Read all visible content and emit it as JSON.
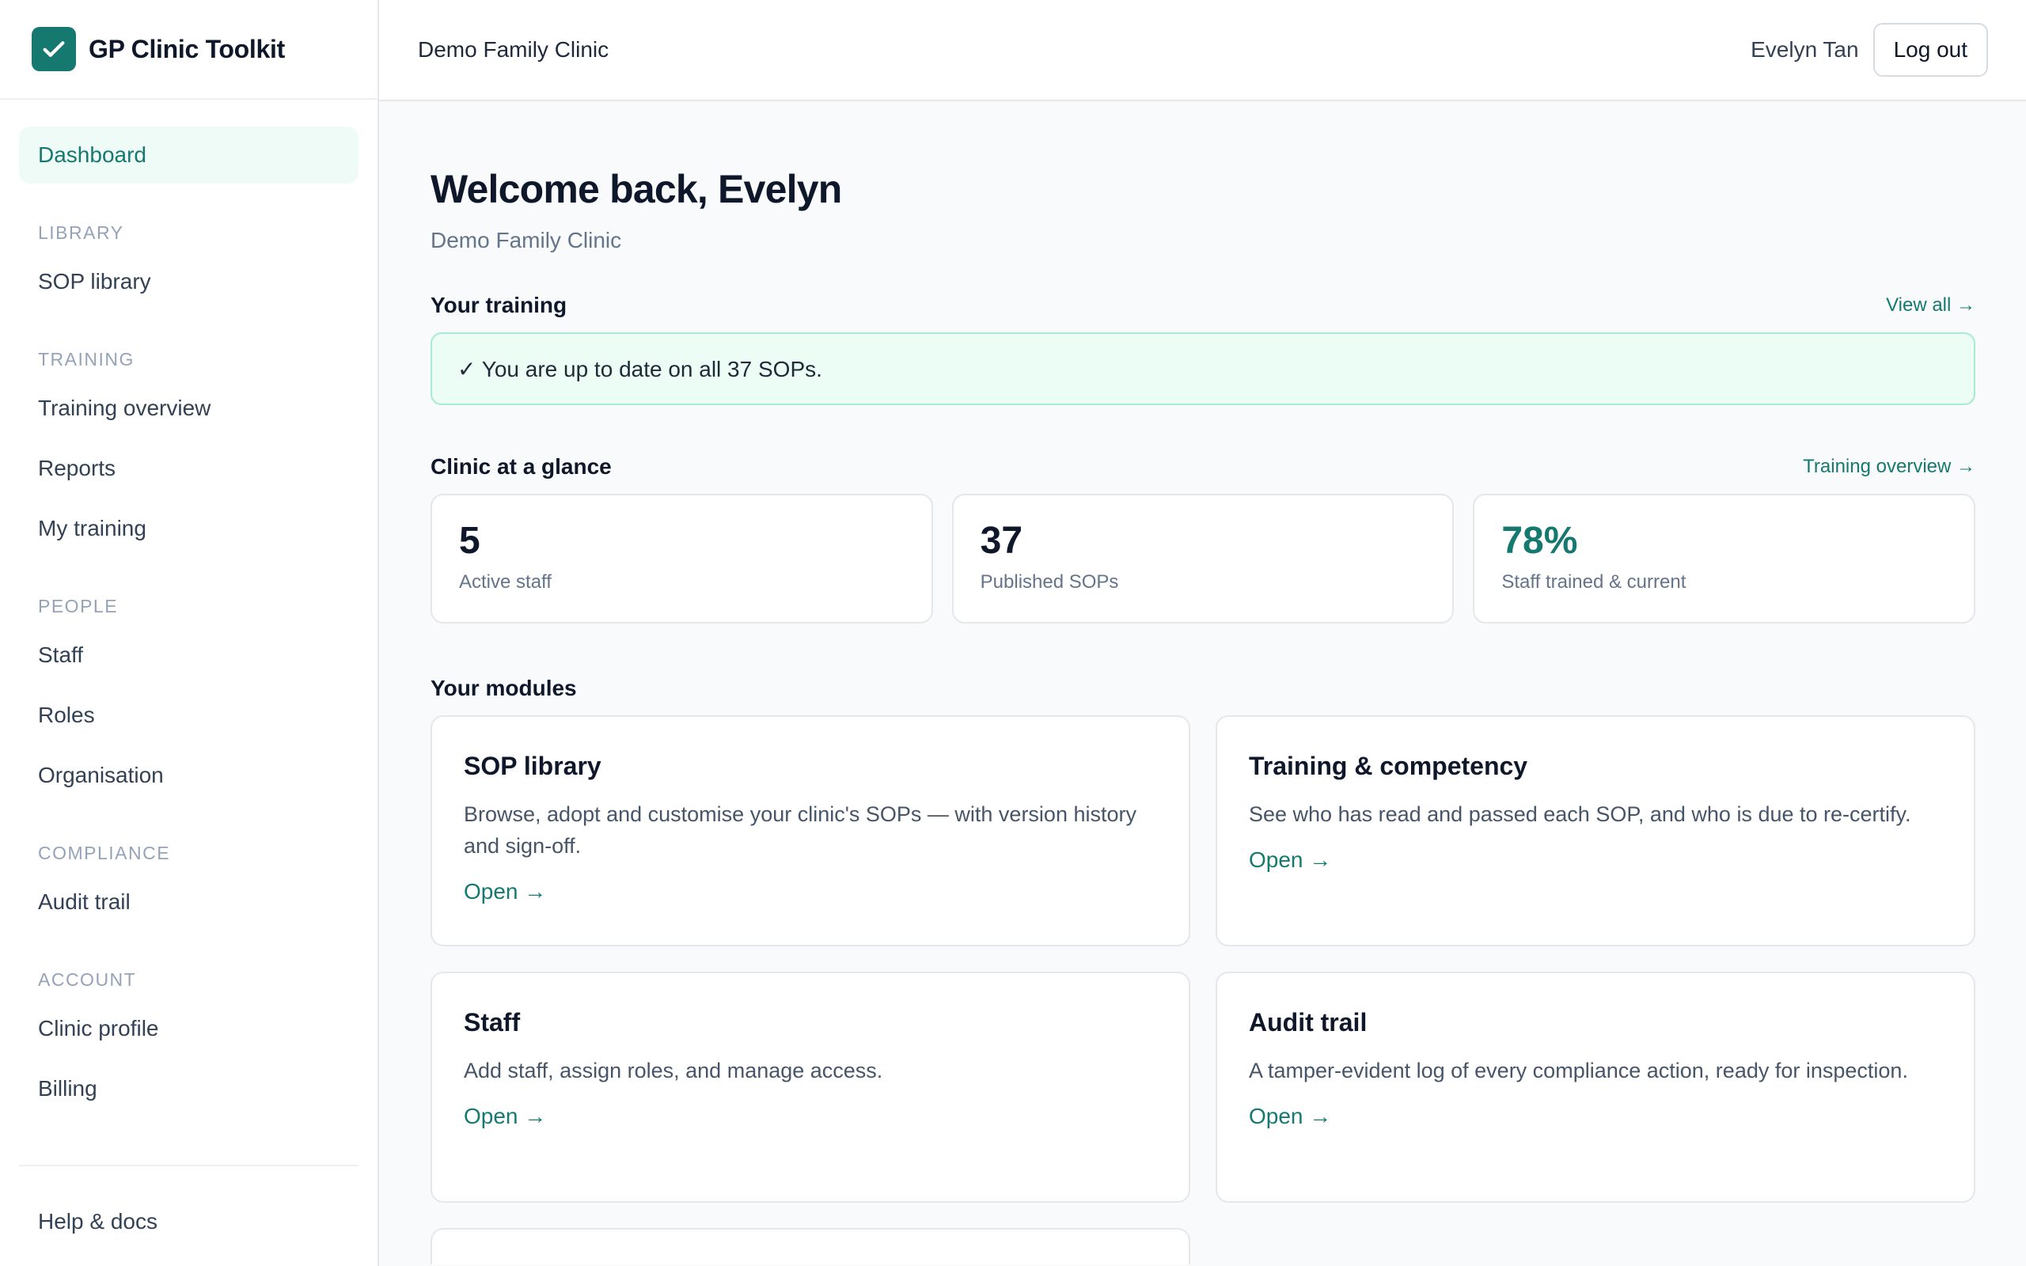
{
  "brand": {
    "name": "GP Clinic Toolkit",
    "logo_icon": "check-icon",
    "accent": "#16796f"
  },
  "sidebar": {
    "dashboard": "Dashboard",
    "sections": [
      {
        "label": "LIBRARY",
        "items": [
          "SOP library"
        ]
      },
      {
        "label": "TRAINING",
        "items": [
          "Training overview",
          "Reports",
          "My training"
        ]
      },
      {
        "label": "PEOPLE",
        "items": [
          "Staff",
          "Roles",
          "Organisation"
        ]
      },
      {
        "label": "COMPLIANCE",
        "items": [
          "Audit trail"
        ]
      },
      {
        "label": "ACCOUNT",
        "items": [
          "Clinic profile",
          "Billing"
        ]
      }
    ],
    "help": "Help & docs"
  },
  "header": {
    "clinic": "Demo Family Clinic",
    "user": "Evelyn Tan",
    "logout": "Log out"
  },
  "main": {
    "welcome": "Welcome back, Evelyn",
    "clinic": "Demo Family Clinic",
    "training": {
      "title": "Your training",
      "link": "View all →",
      "notice": "✓ You are up to date on all 37 SOPs."
    },
    "glance": {
      "title": "Clinic at a glance",
      "link": "Training overview →",
      "stats": [
        {
          "value": "5",
          "label": "Active staff"
        },
        {
          "value": "37",
          "label": "Published SOPs"
        },
        {
          "value": "78%",
          "label": "Staff trained & current"
        }
      ]
    },
    "modules": {
      "title": "Your modules",
      "items": [
        {
          "title": "SOP library",
          "desc": "Browse, adopt and customise your clinic's SOPs — with version history and sign-off.",
          "link": "Open →"
        },
        {
          "title": "Training & competency",
          "desc": "See who has read and passed each SOP, and who is due to re-certify.",
          "link": "Open →"
        },
        {
          "title": "Staff",
          "desc": "Add staff, assign roles, and manage access.",
          "link": "Open →"
        },
        {
          "title": "Audit trail",
          "desc": "A tamper-evident log of every compliance action, ready for inspection.",
          "link": "Open →"
        }
      ]
    }
  }
}
